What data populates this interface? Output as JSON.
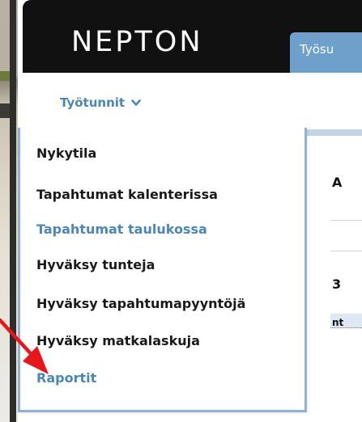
{
  "header": {
    "logo": "NEPTON",
    "tab_label": "Työsu"
  },
  "section": {
    "label": "Työtunnit"
  },
  "background": {
    "fragments": [
      "A",
      "3",
      "nt"
    ]
  },
  "menu": {
    "items": [
      {
        "label": "Nykytila",
        "active": false
      },
      {
        "label": "Tapahtumat kalenterissa",
        "active": false
      },
      {
        "label": "Tapahtumat taulukossa",
        "active": true
      },
      {
        "label": "Hyväksy tunteja",
        "active": false
      },
      {
        "label": "Hyväksy tapahtumapyyntöjä",
        "active": false
      },
      {
        "label": "Hyväksy matkalaskuja",
        "active": false
      },
      {
        "label": "Raportit",
        "active": true
      }
    ]
  },
  "colors": {
    "accent": "#4a86b8",
    "menu_border": "#8fb1d6",
    "topbar": "#111111",
    "tab": "#6f9fcb",
    "annotation_arrow": "#e8151b"
  },
  "icons": {
    "section_toggle": "chevron-down-icon",
    "annotation": "red-arrow-icon"
  }
}
